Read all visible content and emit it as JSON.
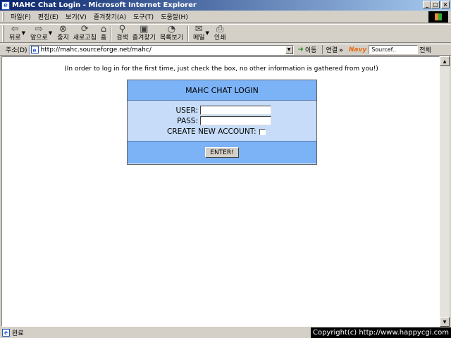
{
  "window": {
    "title": "MAHC Chat Login - Microsoft Internet Explorer",
    "app_icon": "ie-icon",
    "controls": {
      "minimize": "_",
      "maximize": "□",
      "close": "×"
    }
  },
  "menubar": {
    "items": [
      "파일(F)",
      "편집(E)",
      "보기(V)",
      "즐겨찾기(A)",
      "도구(T)",
      "도움말(H)"
    ]
  },
  "toolbar": {
    "buttons": [
      {
        "label": "뒤로",
        "icon": "back-arrow-icon",
        "glyph": "⇦"
      },
      {
        "label": "앞으로",
        "icon": "forward-arrow-icon",
        "glyph": "⇨"
      },
      {
        "label": "중지",
        "icon": "stop-icon",
        "glyph": "⊗"
      },
      {
        "label": "새로고침",
        "icon": "refresh-icon",
        "glyph": "⟳"
      },
      {
        "label": "홈",
        "icon": "home-icon",
        "glyph": "⌂"
      },
      {
        "label": "검색",
        "icon": "search-icon",
        "glyph": "⚲"
      },
      {
        "label": "즐겨찾기",
        "icon": "favorites-icon",
        "glyph": "▣"
      },
      {
        "label": "목록보기",
        "icon": "history-icon",
        "glyph": "◔"
      },
      {
        "label": "메일",
        "icon": "mail-icon",
        "glyph": "✉"
      },
      {
        "label": "인쇄",
        "icon": "print-icon",
        "glyph": "⎙"
      }
    ]
  },
  "addressbar": {
    "label": "주소(D)",
    "url": "http://mahc.sourceforge.net/mahc/",
    "go_label": "이동",
    "links_label": "연결",
    "links_chevron": "»",
    "navy_logo": "Navy",
    "navy_search_value": "Sourcef..",
    "navy_scope": "전체"
  },
  "content": {
    "notice": "(In order to log in for the first time, just check the box, no other information is gathered from you!)",
    "login": {
      "heading": "MAHC CHAT LOGIN",
      "user_label": "USER:",
      "user_value": "",
      "pass_label": "PASS:",
      "pass_value": "",
      "create_label": "CREATE NEW ACCOUNT:",
      "create_checked": false,
      "enter_label": "ENTER!"
    }
  },
  "statusbar": {
    "text": "완료",
    "copyright": "Copyright(c) http://www.happycgi.com"
  },
  "colors": {
    "title_gradient_start": "#0a246a",
    "title_gradient_end": "#a6caf0",
    "login_header": "#7cb2f6",
    "login_body": "#c6dcf8",
    "chrome": "#d4d0c8"
  }
}
